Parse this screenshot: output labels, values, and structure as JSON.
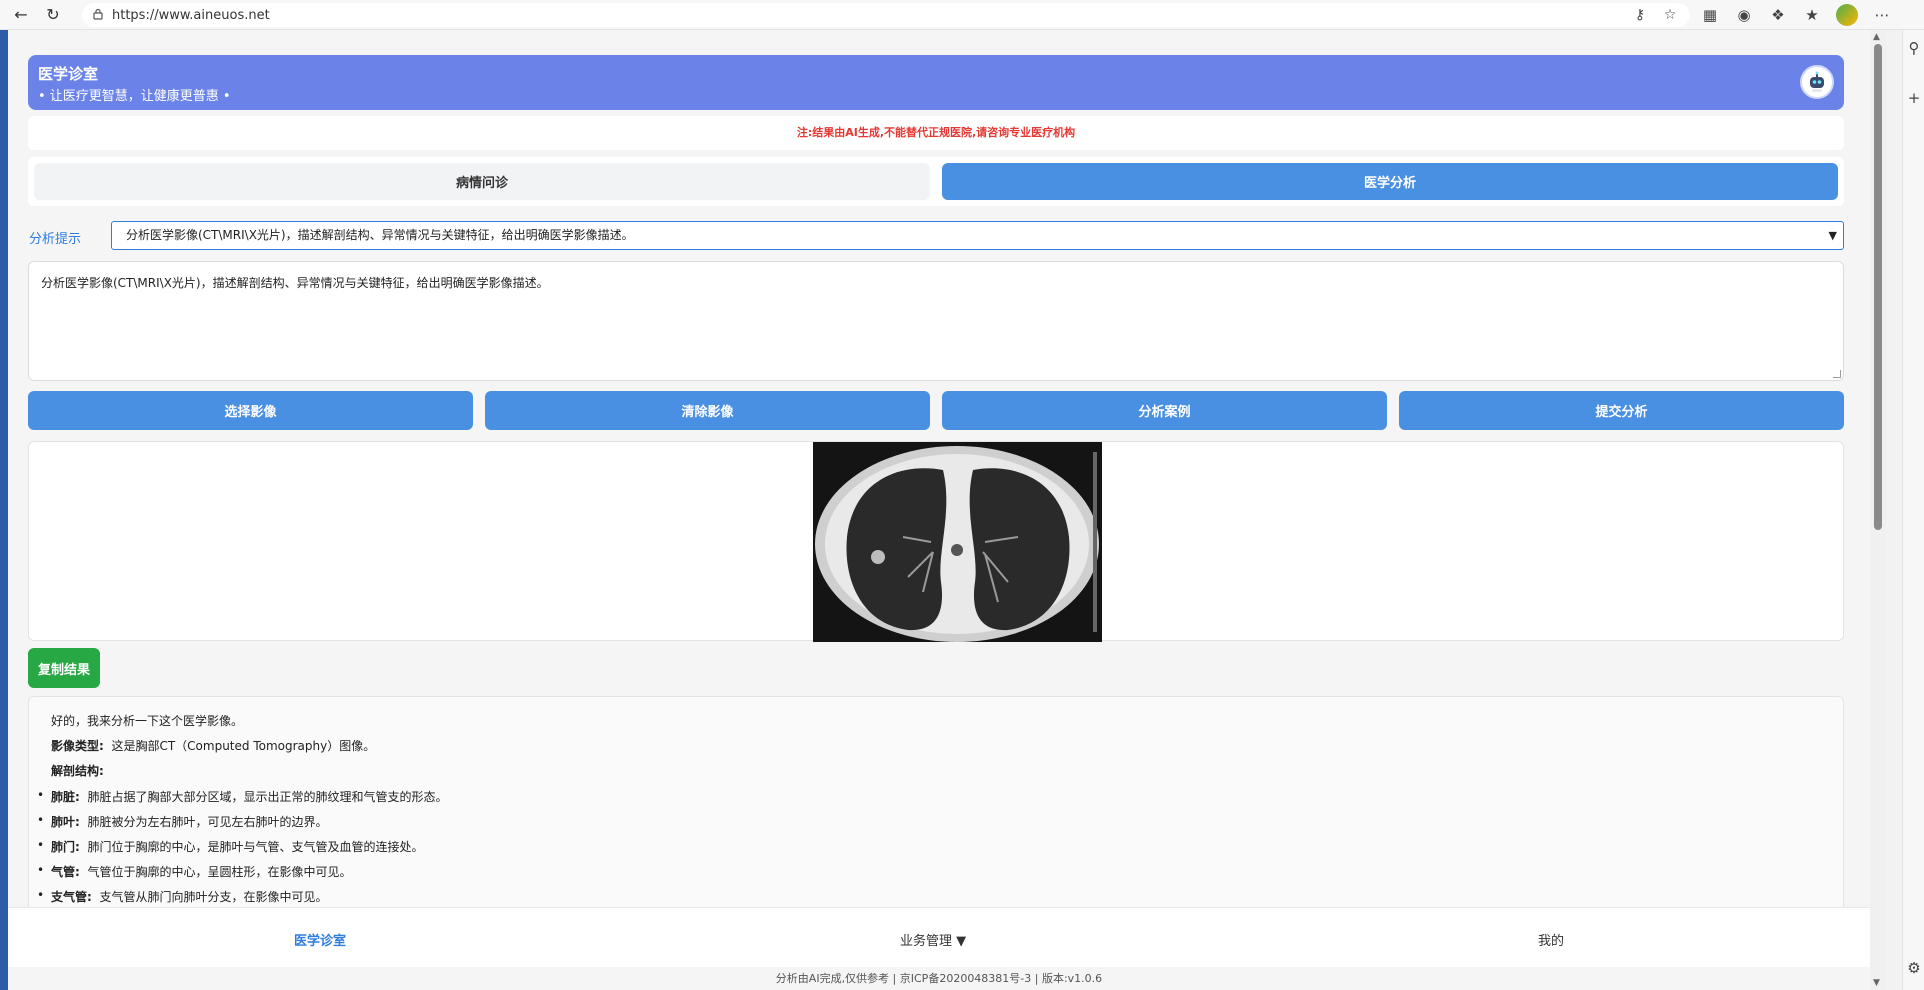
{
  "browser": {
    "url": "https://www.aineuos.net"
  },
  "header": {
    "title": "医学诊室",
    "subtitle": "• 让医疗更智慧，让健康更普惠 •"
  },
  "notice": "注:结果由AI生成,不能替代正规医院,请咨询专业医疗机构",
  "tabs": [
    {
      "label": "病情问诊",
      "active": false
    },
    {
      "label": "医学分析",
      "active": true
    }
  ],
  "analysis": {
    "hint_label": "分析提示",
    "selected_hint": "分析医学影像(CT\\MRI\\X光片)，描述解剖结构、异常情况与关键特征，给出明确医学影像描述。",
    "prompt_text": "分析医学影像(CT\\MRI\\X光片)，描述解剖结构、异常情况与关键特征，给出明确医学影像描述。"
  },
  "buttons": {
    "select_image": "选择影像",
    "clear_image": "清除影像",
    "example": "分析案例",
    "submit": "提交分析",
    "copy_result": "复制结果"
  },
  "result": {
    "intro": "好的，我来分析一下这个医学影像。",
    "image_type_label": "影像类型:",
    "image_type_value": "这是胸部CT（Computed Tomography）图像。",
    "anatomy_heading": "解剖结构:",
    "items": [
      {
        "term": "肺脏:",
        "desc": "肺脏占据了胸部大部分区域，显示出正常的肺纹理和气管支的形态。"
      },
      {
        "term": "肺叶:",
        "desc": "肺脏被分为左右肺叶，可见左右肺叶的边界。"
      },
      {
        "term": "肺门:",
        "desc": "肺门位于胸廓的中心，是肺叶与气管、支气管及血管的连接处。"
      },
      {
        "term": "气管:",
        "desc": "气管位于胸廓的中心，呈圆柱形，在影像中可见。"
      },
      {
        "term": "支气管:",
        "desc": "支气管从肺门向肺叶分支，在影像中可见。"
      }
    ]
  },
  "bottom_nav": {
    "home": "医学诊室",
    "business": "业务管理 ▼",
    "mine": "我的"
  },
  "footer": "分析由AI完成,仅供参考 |  京ICP备2020048381号-3 |  版本:v1.0.6",
  "colors": {
    "header_bg": "#6b83e8",
    "primary_button": "#4a90e2",
    "copy_button": "#28a745",
    "notice_text": "#e53935"
  }
}
